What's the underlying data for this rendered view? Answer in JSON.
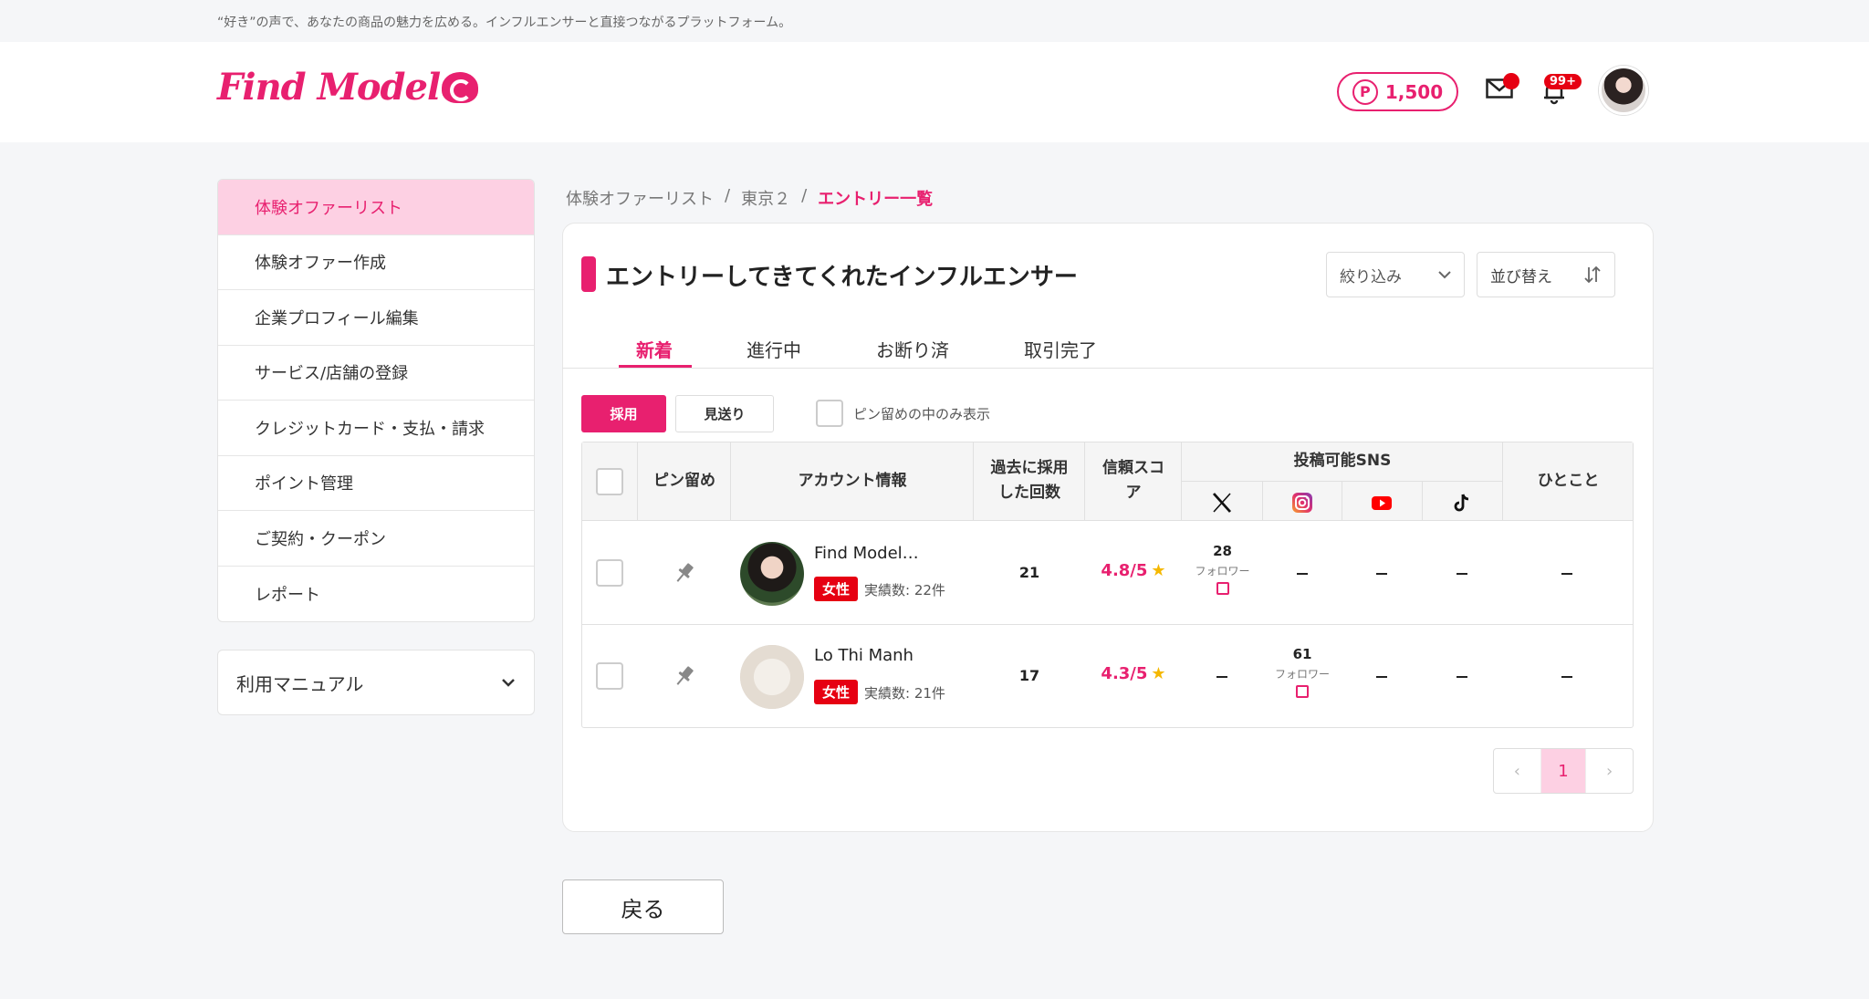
{
  "tagline": "“好き”の声で、あなたの商品の魅力を広める。インフルエンサーと直接つながるプラットフォーム。",
  "logo": {
    "text": "Find Model"
  },
  "header": {
    "points_badge": "P",
    "points": "1,500",
    "notification_count": "99+"
  },
  "sidebar": {
    "items": [
      {
        "label": "体験オファーリスト",
        "active": true
      },
      {
        "label": "体験オファー作成"
      },
      {
        "label": "企業プロフィール編集"
      },
      {
        "label": "サービス/店舗の登録"
      },
      {
        "label": "クレジットカード・支払・請求"
      },
      {
        "label": "ポイント管理"
      },
      {
        "label": "ご契約・クーポン"
      },
      {
        "label": "レポート"
      }
    ],
    "manual_label": "利用マニュアル"
  },
  "breadcrumb": {
    "items": [
      "体験オファーリスト",
      "東京２",
      "エントリー一覧"
    ],
    "separator": "/"
  },
  "main": {
    "title": "エントリーしてきてくれたインフルエンサー",
    "filter_label": "絞り込み",
    "sort_label": "並び替え",
    "tabs": [
      {
        "label": "新着",
        "active": true
      },
      {
        "label": "進行中"
      },
      {
        "label": "お断り済"
      },
      {
        "label": "取引完了"
      }
    ],
    "adopt_button": "採用",
    "skip_button": "見送り",
    "pin_only_label": "ピン留めの中のみ表示"
  },
  "table": {
    "headers": {
      "pin": "ピン留め",
      "account": "アカウント情報",
      "adopted_1": "過去に採用",
      "adopted_2": "した回数",
      "trust_1": "信頼スコ",
      "trust_2": "ア",
      "sns": "投稿可能SNS",
      "comment": "ひとこと"
    },
    "rows": [
      {
        "name": "Find Model…",
        "gender": "女性",
        "record": "実績数: 22件",
        "adopted": "21",
        "score": "4.8/5",
        "x_followers": "28",
        "followers_label": "フォロワー"
      },
      {
        "name": "Lo Thi Manh",
        "gender": "女性",
        "record": "実績数: 21件",
        "adopted": "17",
        "score": "4.3/5",
        "instagram_followers": "61",
        "followers_label": "フォロワー"
      }
    ]
  },
  "pagination": {
    "prev": "‹",
    "current": "1",
    "next": "›"
  },
  "back_button": "戻る",
  "colors": {
    "accent": "#e8206f",
    "accent_light": "#fdd0e3",
    "badge_red": "#e60012"
  }
}
